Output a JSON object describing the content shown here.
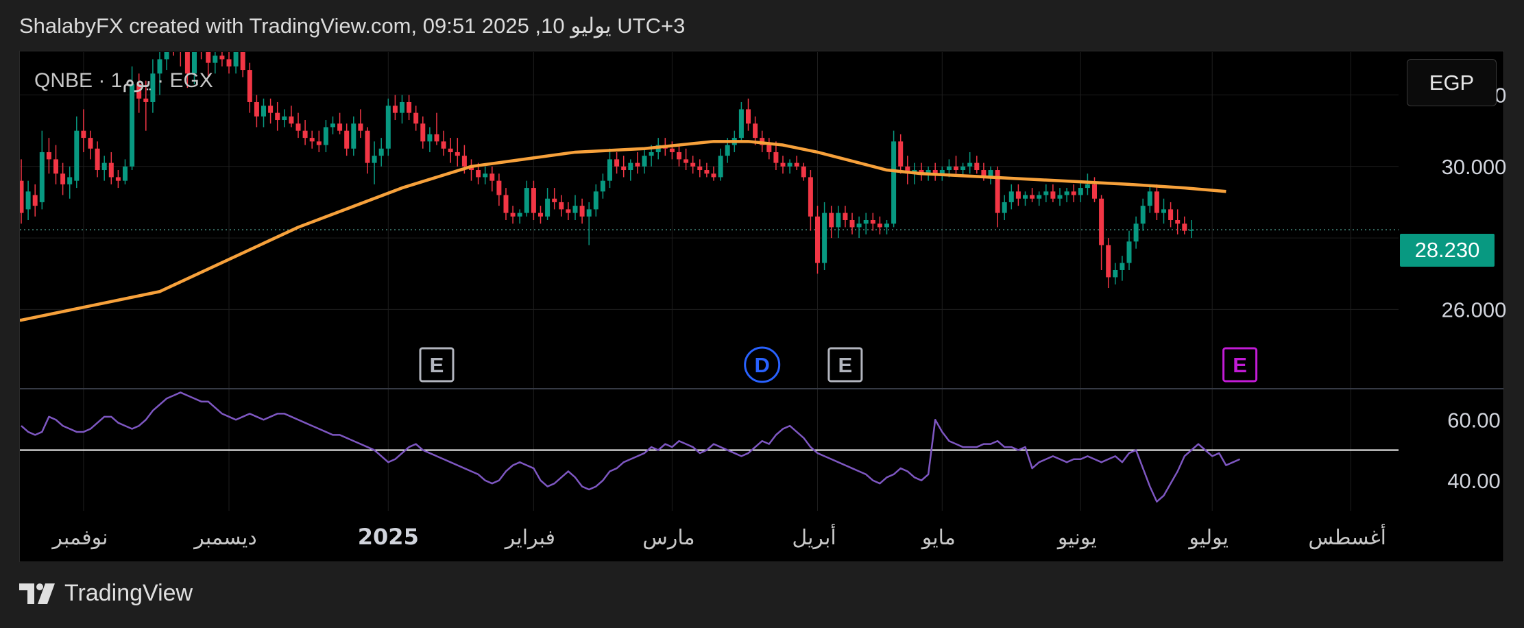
{
  "header": {
    "text": "ShalabyFX created with TradingView.com, 09:51 2025 ,10 يوليو UTC+3"
  },
  "symbol": {
    "label": "QNBE · 1يوم · EGX"
  },
  "currency_button": {
    "label": "EGP"
  },
  "last_price": {
    "label": "28.230",
    "value": 28.23
  },
  "footer": {
    "brand": "TradingView"
  },
  "colors": {
    "up": "#089981",
    "down": "#f23645",
    "ma": "#f7a13b",
    "rsi": "#7e57c2",
    "grid": "#1e1e1e",
    "badge": "#089981"
  },
  "chart_data": [
    {
      "type": "candlestick",
      "symbol": "QNBE",
      "interval": "1يوم",
      "exchange": "EGX",
      "currency": "EGP",
      "ylim": [
        23.8,
        33.2
      ],
      "y_ticks": [
        "32.000",
        "30.000",
        "26.000"
      ],
      "y_tick_values": [
        32,
        30,
        26
      ],
      "x_labels": [
        "نوفمبر",
        "ديسمبر",
        "2025",
        "فبراير",
        "مارس",
        "أبريل",
        "مايو",
        "يونيو",
        "يوليو",
        "أغسطس"
      ],
      "x_label_bar_index": [
        9,
        30,
        53,
        74,
        94,
        115,
        133,
        153,
        172,
        192
      ],
      "last_price": 28.23,
      "candles": [
        [
          29.6,
          30.2,
          28.4,
          28.7
        ],
        [
          28.8,
          29.6,
          28.5,
          29.3
        ],
        [
          29.2,
          29.5,
          28.6,
          28.9
        ],
        [
          29.0,
          31.0,
          28.8,
          30.4
        ],
        [
          30.4,
          30.8,
          29.8,
          30.2
        ],
        [
          30.2,
          30.6,
          29.5,
          29.8
        ],
        [
          29.8,
          30.1,
          29.2,
          29.5
        ],
        [
          29.5,
          30.0,
          29.1,
          29.7
        ],
        [
          29.6,
          31.4,
          29.4,
          31.0
        ],
        [
          31.0,
          31.6,
          30.4,
          30.8
        ],
        [
          30.8,
          31.0,
          30.2,
          30.5
        ],
        [
          30.5,
          30.7,
          29.7,
          29.9
        ],
        [
          29.9,
          30.3,
          29.6,
          30.1
        ],
        [
          30.1,
          30.4,
          29.5,
          29.7
        ],
        [
          29.7,
          29.9,
          29.4,
          29.6
        ],
        [
          29.6,
          30.2,
          29.5,
          30.0
        ],
        [
          30.0,
          32.8,
          29.9,
          32.3
        ],
        [
          32.3,
          32.6,
          31.5,
          31.9
        ],
        [
          31.9,
          32.4,
          31.0,
          31.8
        ],
        [
          31.8,
          33.0,
          31.5,
          32.6
        ],
        [
          32.6,
          33.2,
          32.0,
          33.0
        ],
        [
          33.0,
          34.2,
          32.7,
          33.8
        ],
        [
          33.8,
          34.0,
          33.1,
          33.4
        ],
        [
          33.4,
          34.2,
          32.8,
          33.2
        ],
        [
          33.2,
          33.5,
          32.2,
          32.6
        ],
        [
          32.6,
          33.8,
          32.3,
          33.5
        ],
        [
          33.5,
          33.9,
          33.0,
          33.2
        ],
        [
          33.2,
          33.4,
          32.5,
          32.9
        ],
        [
          32.9,
          33.3,
          32.6,
          33.1
        ],
        [
          33.1,
          33.5,
          32.8,
          33.0
        ],
        [
          33.0,
          33.2,
          32.6,
          32.8
        ],
        [
          32.8,
          33.7,
          32.6,
          33.4
        ],
        [
          33.4,
          33.6,
          32.5,
          32.7
        ],
        [
          32.7,
          32.9,
          31.5,
          31.8
        ],
        [
          31.8,
          32.0,
          31.1,
          31.4
        ],
        [
          31.4,
          31.9,
          31.1,
          31.7
        ],
        [
          31.7,
          31.9,
          31.2,
          31.5
        ],
        [
          31.5,
          31.8,
          31.0,
          31.3
        ],
        [
          31.3,
          31.6,
          31.1,
          31.4
        ],
        [
          31.4,
          31.7,
          31.1,
          31.2
        ],
        [
          31.2,
          31.5,
          30.8,
          31.0
        ],
        [
          31.0,
          31.3,
          30.6,
          30.8
        ],
        [
          30.8,
          31.0,
          30.5,
          30.7
        ],
        [
          30.7,
          31.0,
          30.4,
          30.6
        ],
        [
          30.6,
          31.3,
          30.4,
          31.1
        ],
        [
          31.1,
          31.4,
          30.9,
          31.2
        ],
        [
          31.2,
          31.5,
          30.9,
          31.0
        ],
        [
          31.0,
          31.2,
          30.3,
          30.5
        ],
        [
          30.5,
          31.4,
          30.3,
          31.2
        ],
        [
          31.2,
          31.6,
          30.8,
          31.0
        ],
        [
          31.0,
          31.1,
          29.8,
          30.1
        ],
        [
          30.1,
          30.7,
          29.5,
          30.3
        ],
        [
          30.3,
          30.8,
          30.0,
          30.5
        ],
        [
          30.5,
          31.9,
          30.3,
          31.7
        ],
        [
          31.7,
          32.0,
          31.3,
          31.5
        ],
        [
          31.5,
          32.0,
          31.2,
          31.8
        ],
        [
          31.8,
          32.0,
          31.3,
          31.5
        ],
        [
          31.5,
          31.7,
          31.0,
          31.2
        ],
        [
          31.2,
          31.4,
          30.5,
          30.7
        ],
        [
          30.7,
          31.1,
          30.4,
          30.9
        ],
        [
          30.9,
          31.5,
          30.6,
          30.7
        ],
        [
          30.7,
          31.0,
          30.3,
          30.5
        ],
        [
          30.5,
          30.8,
          30.1,
          30.4
        ],
        [
          30.4,
          30.8,
          30.0,
          30.3
        ],
        [
          30.3,
          30.6,
          29.8,
          30.0
        ],
        [
          30.0,
          30.2,
          29.6,
          29.9
        ],
        [
          29.9,
          30.1,
          29.5,
          29.7
        ],
        [
          29.7,
          30.0,
          29.5,
          29.8
        ],
        [
          29.8,
          30.0,
          29.3,
          29.6
        ],
        [
          29.6,
          29.8,
          28.9,
          29.2
        ],
        [
          29.2,
          29.4,
          28.5,
          28.7
        ],
        [
          28.7,
          28.9,
          28.4,
          28.6
        ],
        [
          28.6,
          28.8,
          28.4,
          28.7
        ],
        [
          28.7,
          29.6,
          28.6,
          29.4
        ],
        [
          29.4,
          29.6,
          28.5,
          28.7
        ],
        [
          28.7,
          28.9,
          28.4,
          28.6
        ],
        [
          28.6,
          29.4,
          28.5,
          29.1
        ],
        [
          29.1,
          29.4,
          28.8,
          29.0
        ],
        [
          29.0,
          29.2,
          28.6,
          28.8
        ],
        [
          28.8,
          29.0,
          28.5,
          28.7
        ],
        [
          28.7,
          29.2,
          28.5,
          28.9
        ],
        [
          28.9,
          29.1,
          28.4,
          28.6
        ],
        [
          28.6,
          29.0,
          27.8,
          28.8
        ],
        [
          28.8,
          29.5,
          28.6,
          29.3
        ],
        [
          29.3,
          29.8,
          29.1,
          29.6
        ],
        [
          29.6,
          30.5,
          29.4,
          30.2
        ],
        [
          30.2,
          30.4,
          29.8,
          30.0
        ],
        [
          30.0,
          30.3,
          29.7,
          29.9
        ],
        [
          29.9,
          30.2,
          29.6,
          30.1
        ],
        [
          30.1,
          30.4,
          29.8,
          30.0
        ],
        [
          30.0,
          30.5,
          29.8,
          30.3
        ],
        [
          30.3,
          30.6,
          30.0,
          30.4
        ],
        [
          30.4,
          30.8,
          30.2,
          30.6
        ],
        [
          30.6,
          30.8,
          30.3,
          30.5
        ],
        [
          30.5,
          30.7,
          30.2,
          30.4
        ],
        [
          30.4,
          30.6,
          30.0,
          30.2
        ],
        [
          30.2,
          30.5,
          29.9,
          30.1
        ],
        [
          30.1,
          30.3,
          29.8,
          30.0
        ],
        [
          30.0,
          30.2,
          29.7,
          29.9
        ],
        [
          29.9,
          30.1,
          29.7,
          29.8
        ],
        [
          29.8,
          30.0,
          29.6,
          29.7
        ],
        [
          29.7,
          30.5,
          29.6,
          30.3
        ],
        [
          30.3,
          30.8,
          30.1,
          30.6
        ],
        [
          30.6,
          31.0,
          30.4,
          30.8
        ],
        [
          30.8,
          31.8,
          30.7,
          31.6
        ],
        [
          31.6,
          31.9,
          31.0,
          31.2
        ],
        [
          31.2,
          31.4,
          30.6,
          30.8
        ],
        [
          30.8,
          31.0,
          30.4,
          30.6
        ],
        [
          30.6,
          30.8,
          30.2,
          30.4
        ],
        [
          30.4,
          30.7,
          29.9,
          30.1
        ],
        [
          30.1,
          30.3,
          29.8,
          30.0
        ],
        [
          30.0,
          30.2,
          29.8,
          30.1
        ],
        [
          30.1,
          30.3,
          29.9,
          30.0
        ],
        [
          30.0,
          30.1,
          29.6,
          29.7
        ],
        [
          29.7,
          29.9,
          28.2,
          28.6
        ],
        [
          28.6,
          28.9,
          27.0,
          27.3
        ],
        [
          27.3,
          29.0,
          27.1,
          28.7
        ],
        [
          28.7,
          28.9,
          28.0,
          28.3
        ],
        [
          28.3,
          28.9,
          28.0,
          28.7
        ],
        [
          28.7,
          28.9,
          28.3,
          28.5
        ],
        [
          28.5,
          28.7,
          28.1,
          28.3
        ],
        [
          28.3,
          28.6,
          28.0,
          28.4
        ],
        [
          28.4,
          28.7,
          28.1,
          28.5
        ],
        [
          28.5,
          28.7,
          28.2,
          28.4
        ],
        [
          28.4,
          28.6,
          28.1,
          28.3
        ],
        [
          28.3,
          28.5,
          28.1,
          28.4
        ],
        [
          28.4,
          31.0,
          28.3,
          30.7
        ],
        [
          30.7,
          30.9,
          29.8,
          30.0
        ],
        [
          30.0,
          30.3,
          29.5,
          29.8
        ],
        [
          29.8,
          30.1,
          29.5,
          29.9
        ],
        [
          29.9,
          30.1,
          29.6,
          29.8
        ],
        [
          29.8,
          30.0,
          29.6,
          29.9
        ],
        [
          29.9,
          30.1,
          29.6,
          29.8
        ],
        [
          29.8,
          30.0,
          29.6,
          29.9
        ],
        [
          29.9,
          30.2,
          29.7,
          30.0
        ],
        [
          30.0,
          30.3,
          29.8,
          29.9
        ],
        [
          29.9,
          30.1,
          29.7,
          30.0
        ],
        [
          30.0,
          30.4,
          29.8,
          30.1
        ],
        [
          30.1,
          30.3,
          29.8,
          29.9
        ],
        [
          29.9,
          30.1,
          29.6,
          29.7
        ],
        [
          29.7,
          30.0,
          29.5,
          29.9
        ],
        [
          29.9,
          30.0,
          28.3,
          28.7
        ],
        [
          28.7,
          29.2,
          28.5,
          29.0
        ],
        [
          29.0,
          29.5,
          28.8,
          29.3
        ],
        [
          29.3,
          29.5,
          28.9,
          29.1
        ],
        [
          29.1,
          29.3,
          28.9,
          29.2
        ],
        [
          29.2,
          29.4,
          29.0,
          29.1
        ],
        [
          29.1,
          29.3,
          28.9,
          29.2
        ],
        [
          29.2,
          29.5,
          29.0,
          29.3
        ],
        [
          29.3,
          29.5,
          29.0,
          29.1
        ],
        [
          29.1,
          29.4,
          28.9,
          29.2
        ],
        [
          29.2,
          29.4,
          29.0,
          29.3
        ],
        [
          29.3,
          29.5,
          29.0,
          29.2
        ],
        [
          29.2,
          29.6,
          29.0,
          29.4
        ],
        [
          29.4,
          29.8,
          29.2,
          29.5
        ],
        [
          29.5,
          29.7,
          29.0,
          29.1
        ],
        [
          29.1,
          29.2,
          27.1,
          27.8
        ],
        [
          27.8,
          28.0,
          26.6,
          26.9
        ],
        [
          26.9,
          27.3,
          26.7,
          27.1
        ],
        [
          27.1,
          27.5,
          26.8,
          27.3
        ],
        [
          27.3,
          28.2,
          27.1,
          27.9
        ],
        [
          27.9,
          28.6,
          27.7,
          28.4
        ],
        [
          28.4,
          29.1,
          28.2,
          28.9
        ],
        [
          28.9,
          29.5,
          28.7,
          29.3
        ],
        [
          29.3,
          29.5,
          28.5,
          28.7
        ],
        [
          28.7,
          29.1,
          28.4,
          28.8
        ],
        [
          28.8,
          29.0,
          28.3,
          28.5
        ],
        [
          28.5,
          28.8,
          28.1,
          28.4
        ],
        [
          28.4,
          28.6,
          28.1,
          28.2
        ],
        [
          28.2,
          28.5,
          28.0,
          28.23
        ]
      ],
      "ma_line": {
        "x": [
          0,
          20,
          40,
          55,
          65,
          80,
          90,
          100,
          105,
          110,
          115,
          125,
          130,
          140,
          150,
          160,
          168,
          174
        ],
        "y": [
          25.7,
          26.5,
          28.3,
          29.4,
          30.0,
          30.4,
          30.5,
          30.7,
          30.7,
          30.6,
          30.4,
          29.9,
          29.8,
          29.7,
          29.6,
          29.5,
          29.4,
          29.3
        ]
      },
      "event_markers": [
        {
          "label": "E",
          "bar": 60,
          "color": "#b2b5be"
        },
        {
          "label": "D",
          "bar": 107,
          "color": "#2962ff"
        },
        {
          "label": "E",
          "bar": 119,
          "color": "#b2b5be"
        },
        {
          "label": "E",
          "bar": 176,
          "color": "#c21cd6"
        }
      ]
    },
    {
      "type": "line",
      "name": "",
      "ylim": [
        30,
        70
      ],
      "y_ticks": [
        "60.00",
        "40.00"
      ],
      "y_tick_values": [
        60,
        40
      ],
      "reference_line": 50,
      "values": [
        58,
        56,
        55,
        56,
        61,
        60,
        58,
        57,
        56,
        56,
        57,
        59,
        61,
        61,
        59,
        58,
        57,
        58,
        60,
        63,
        65,
        67,
        68,
        69,
        68,
        67,
        66,
        66,
        64,
        62,
        61,
        60,
        61,
        62,
        61,
        60,
        61,
        62,
        62,
        61,
        60,
        59,
        58,
        57,
        56,
        55,
        55,
        54,
        53,
        52,
        51,
        50,
        48,
        46,
        47,
        49,
        51,
        52,
        50,
        49,
        48,
        47,
        46,
        45,
        44,
        43,
        42,
        40,
        39,
        40,
        43,
        45,
        46,
        45,
        44,
        40,
        38,
        39,
        41,
        43,
        41,
        38,
        37,
        38,
        40,
        43,
        44,
        46,
        47,
        48,
        49,
        51,
        50,
        52,
        51,
        53,
        52,
        51,
        49,
        50,
        52,
        51,
        50,
        49,
        48,
        49,
        51,
        53,
        52,
        55,
        57,
        58,
        56,
        54,
        51,
        49,
        48,
        47,
        46,
        45,
        44,
        43,
        42,
        40,
        39,
        41,
        42,
        44,
        43,
        41,
        40,
        42,
        60,
        56,
        53,
        52,
        51,
        51,
        51,
        52,
        52,
        53,
        51,
        51,
        50,
        51,
        44,
        46,
        47,
        48,
        47,
        46,
        47,
        47,
        48,
        47,
        46,
        47,
        48,
        46,
        49,
        50,
        44,
        38,
        33,
        35,
        39,
        43,
        48,
        50,
        52,
        50,
        48,
        49,
        45,
        46,
        47
      ]
    }
  ]
}
